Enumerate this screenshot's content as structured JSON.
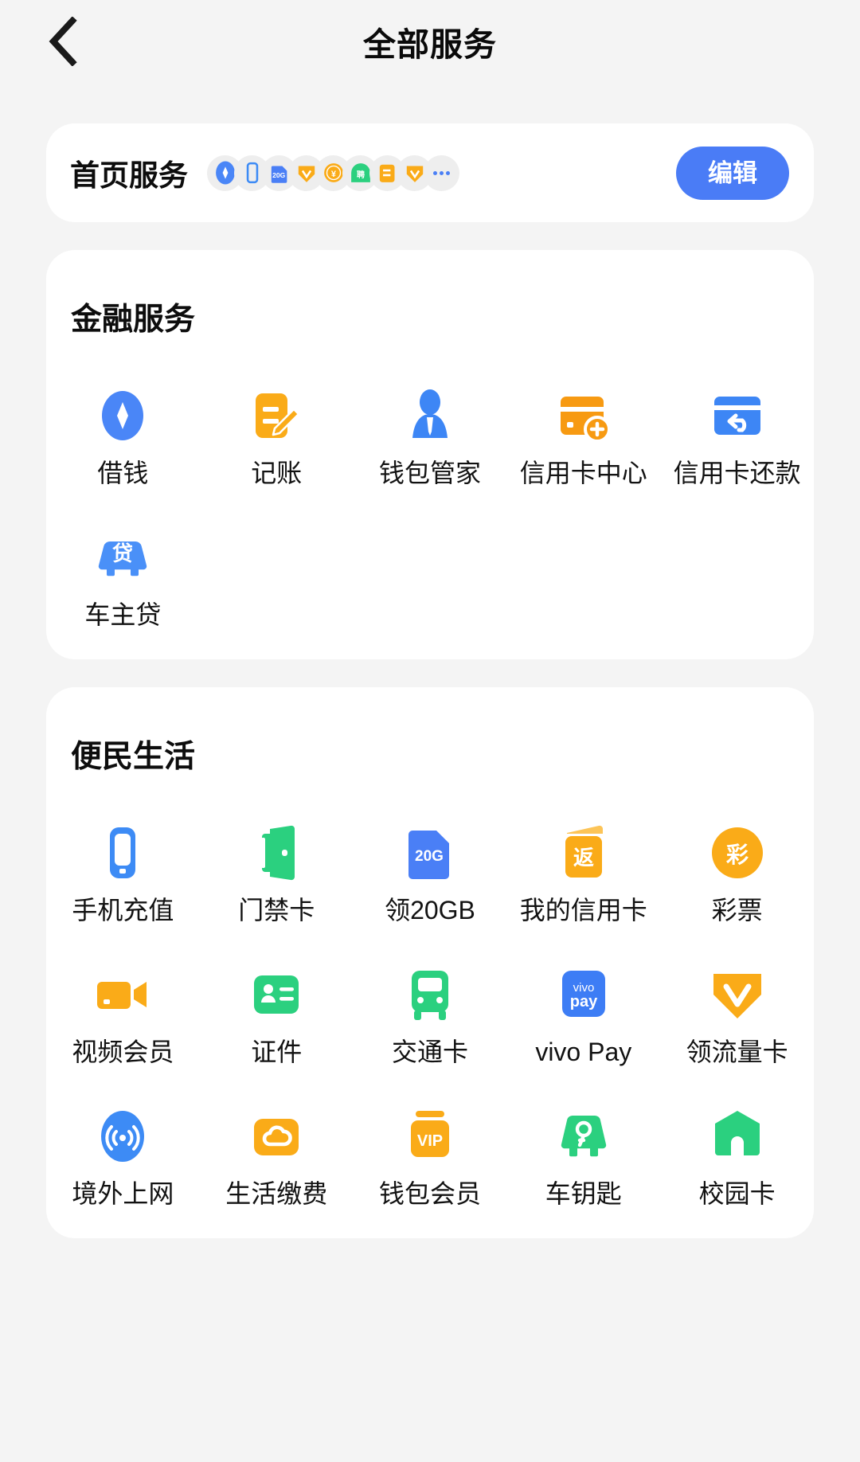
{
  "header": {
    "back_icon": "chevron-left-icon",
    "title": "全部服务"
  },
  "home_services": {
    "title": "首页服务",
    "edit_label": "编辑",
    "more_icon": "ellipsis-icon",
    "stack_icons": [
      "borrow-money-icon",
      "phone-recharge-icon",
      "20gb-sim-icon",
      "v-coupon-icon",
      "yuan-coin-icon",
      "recruit-icon",
      "bookkeeping-icon",
      "v-data-card-icon"
    ]
  },
  "sections": [
    {
      "title": "金融服务",
      "items": [
        {
          "label": "借钱",
          "icon": "borrow-money-icon",
          "color": "#4a86f7"
        },
        {
          "label": "记账",
          "icon": "bookkeeping-icon",
          "color": "#faab18"
        },
        {
          "label": "钱包管家",
          "icon": "wallet-butler-icon",
          "color": "#4a86f7"
        },
        {
          "label": "信用卡中心",
          "icon": "credit-card-center-icon",
          "color": "#f79a12"
        },
        {
          "label": "信用卡还款",
          "icon": "credit-card-repay-icon",
          "color": "#3d86f5"
        },
        {
          "label": "车主贷",
          "icon": "car-loan-icon",
          "color": "#4a90f8"
        }
      ]
    },
    {
      "title": "便民生活",
      "items": [
        {
          "label": "手机充值",
          "icon": "phone-recharge-icon",
          "color": "#3d8bf5"
        },
        {
          "label": "门禁卡",
          "icon": "access-card-icon",
          "color": "#2bd07f"
        },
        {
          "label": "领20GB",
          "icon": "20gb-sim-icon",
          "color": "#4a7ff6"
        },
        {
          "label": "我的信用卡",
          "icon": "my-credit-card-icon",
          "color": "#faab18"
        },
        {
          "label": "彩票",
          "icon": "lottery-icon",
          "color": "#faab18"
        },
        {
          "label": "视频会员",
          "icon": "video-membership-icon",
          "color": "#faab18"
        },
        {
          "label": "证件",
          "icon": "id-document-icon",
          "color": "#2bd07f"
        },
        {
          "label": "交通卡",
          "icon": "transit-card-icon",
          "color": "#2bd07f"
        },
        {
          "label": "vivo Pay",
          "icon": "vivo-pay-icon",
          "color": "#3d7df5"
        },
        {
          "label": "领流量卡",
          "icon": "data-card-icon",
          "color": "#faab18"
        },
        {
          "label": "境外上网",
          "icon": "overseas-internet-icon",
          "color": "#3d8bf5"
        },
        {
          "label": "生活缴费",
          "icon": "utility-payment-icon",
          "color": "#faab18"
        },
        {
          "label": "钱包会员",
          "icon": "wallet-vip-icon",
          "color": "#faab18"
        },
        {
          "label": "车钥匙",
          "icon": "car-key-icon",
          "color": "#2bd07f"
        },
        {
          "label": "校园卡",
          "icon": "campus-card-icon",
          "color": "#2bd07f"
        }
      ]
    }
  ],
  "theme": {
    "accent": "#4a7cf6",
    "page_bg": "#f4f4f4",
    "card_bg": "#ffffff",
    "text": "#121212"
  }
}
